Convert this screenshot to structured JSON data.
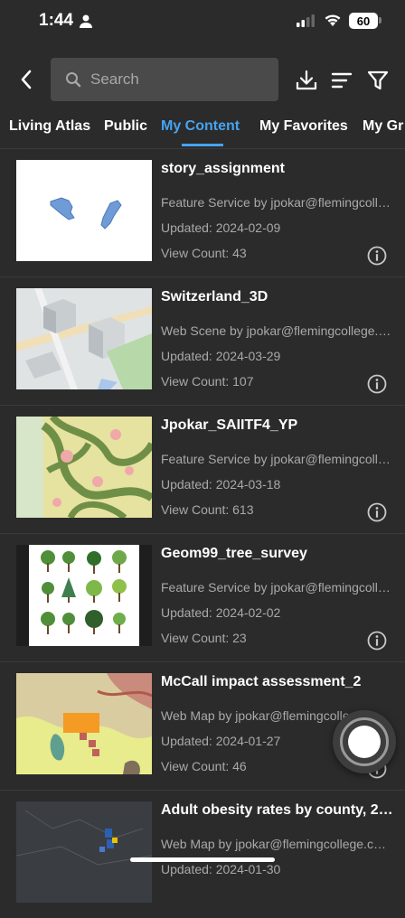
{
  "status": {
    "time": "1:44",
    "battery": "60"
  },
  "search": {
    "placeholder": "Search"
  },
  "tabs": [
    "Living Atlas",
    "Public",
    "My Content",
    "My Favorites",
    "My Gr"
  ],
  "active_tab": "My Content",
  "colors": {
    "accent": "#46a3f0",
    "background": "#2b2b2b"
  },
  "items": [
    {
      "title": "story_assignment",
      "desc": "Feature Service by jpokar@flemingcoll…",
      "updated": "Updated: 2024-02-09",
      "views": "View Count: 43"
    },
    {
      "title": "Switzerland_3D",
      "desc": "Web Scene by jpokar@flemingcollege.…",
      "updated": "Updated: 2024-03-29",
      "views": "View Count: 107"
    },
    {
      "title": "Jpokar_SAIITF4_YP",
      "desc": "Feature Service by jpokar@flemingcoll…",
      "updated": "Updated: 2024-03-18",
      "views": "View Count: 613"
    },
    {
      "title": "Geom99_tree_survey",
      "desc": "Feature Service by jpokar@flemingcoll…",
      "updated": "Updated: 2024-02-02",
      "views": "View Count: 23"
    },
    {
      "title": "McCall impact assessment_2",
      "desc": "Web Map by jpokar@flemingcolle…",
      "updated": "Updated: 2024-01-27",
      "views": "View Count: 46"
    },
    {
      "title": "Adult obesity rates by county, 2…",
      "desc": "Web Map by jpokar@flemingcollege.c…",
      "updated": "Updated: 2024-01-30",
      "views": ""
    }
  ]
}
